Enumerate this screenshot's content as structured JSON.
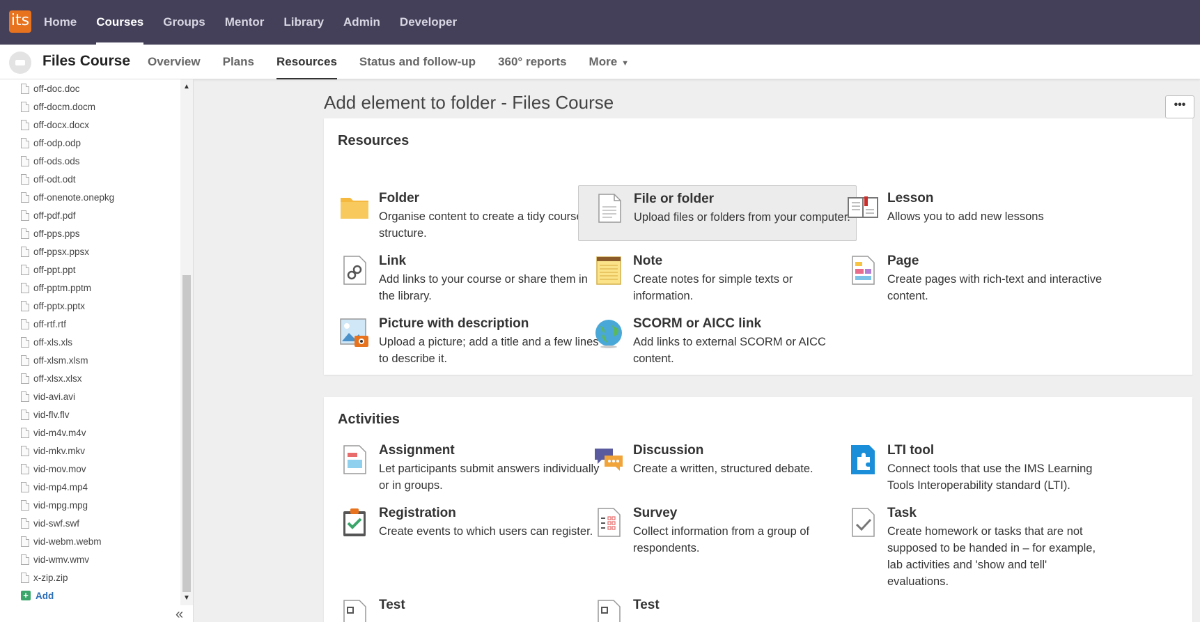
{
  "topnav": {
    "logo_text": "its",
    "items": [
      "Home",
      "Courses",
      "Groups",
      "Mentor",
      "Library",
      "Admin",
      "Developer"
    ],
    "active": "Courses"
  },
  "course": {
    "title": "Files Course",
    "tabs": [
      "Overview",
      "Plans",
      "Resources",
      "Status and follow-up",
      "360° reports",
      "More"
    ],
    "active_tab": "Resources"
  },
  "sidebar": {
    "files": [
      "off-doc.doc",
      "off-docm.docm",
      "off-docx.docx",
      "off-odp.odp",
      "off-ods.ods",
      "off-odt.odt",
      "off-onenote.onepkg",
      "off-pdf.pdf",
      "off-pps.pps",
      "off-ppsx.ppsx",
      "off-ppt.ppt",
      "off-pptm.pptm",
      "off-pptx.pptx",
      "off-rtf.rtf",
      "off-xls.xls",
      "off-xlsm.xlsm",
      "off-xlsx.xlsx",
      "vid-avi.avi",
      "vid-flv.flv",
      "vid-m4v.m4v",
      "vid-mkv.mkv",
      "vid-mov.mov",
      "vid-mp4.mp4",
      "vid-mpg.mpg",
      "vid-swf.swf",
      "vid-webm.webm",
      "vid-wmv.wmv",
      "x-zip.zip"
    ],
    "add_label": "Add"
  },
  "main": {
    "title": "Add element to folder - Files Course",
    "more_label": "•••",
    "resources": {
      "heading": "Resources",
      "items": [
        {
          "title": "Folder",
          "desc": "Organise content to create a tidy course structure.",
          "icon": "folder-icon"
        },
        {
          "title": "File or folder",
          "desc": "Upload files or folders from your computer.",
          "icon": "file-icon"
        },
        {
          "title": "Lesson",
          "desc": "Allows you to add new lessons",
          "icon": "lesson-icon"
        },
        {
          "title": "Link",
          "desc": "Add links to your course or share them in the library.",
          "icon": "link-icon"
        },
        {
          "title": "Note",
          "desc": "Create notes for simple texts or information.",
          "icon": "note-icon"
        },
        {
          "title": "Page",
          "desc": "Create pages with rich-text and interactive content.",
          "icon": "page-icon"
        },
        {
          "title": "Picture with description",
          "desc": "Upload a picture; add a title and a few lines to describe it.",
          "icon": "picture-icon"
        },
        {
          "title": "SCORM or AICC link",
          "desc": "Add links to external SCORM or AICC content.",
          "icon": "globe-icon"
        }
      ]
    },
    "activities": {
      "heading": "Activities",
      "items": [
        {
          "title": "Assignment",
          "desc": "Let participants submit answers individually or in groups.",
          "icon": "assignment-icon"
        },
        {
          "title": "Discussion",
          "desc": "Create a written, structured debate.",
          "icon": "discussion-icon"
        },
        {
          "title": "LTI tool",
          "desc": "Connect tools that use the IMS Learning Tools Interoperability standard (LTI).",
          "icon": "lti-icon"
        },
        {
          "title": "Registration",
          "desc": "Create events to which users can register.",
          "icon": "registration-icon"
        },
        {
          "title": "Survey",
          "desc": "Collect information from a group of respondents.",
          "icon": "survey-icon"
        },
        {
          "title": "Task",
          "desc": "Create homework or tasks that are not supposed to be handed in – for example, lab activities and 'show and tell' evaluations.",
          "icon": "task-icon"
        },
        {
          "title": "Test",
          "desc": "",
          "icon": "test-icon"
        },
        {
          "title": "Test",
          "desc": "",
          "icon": "test-icon"
        }
      ]
    }
  }
}
